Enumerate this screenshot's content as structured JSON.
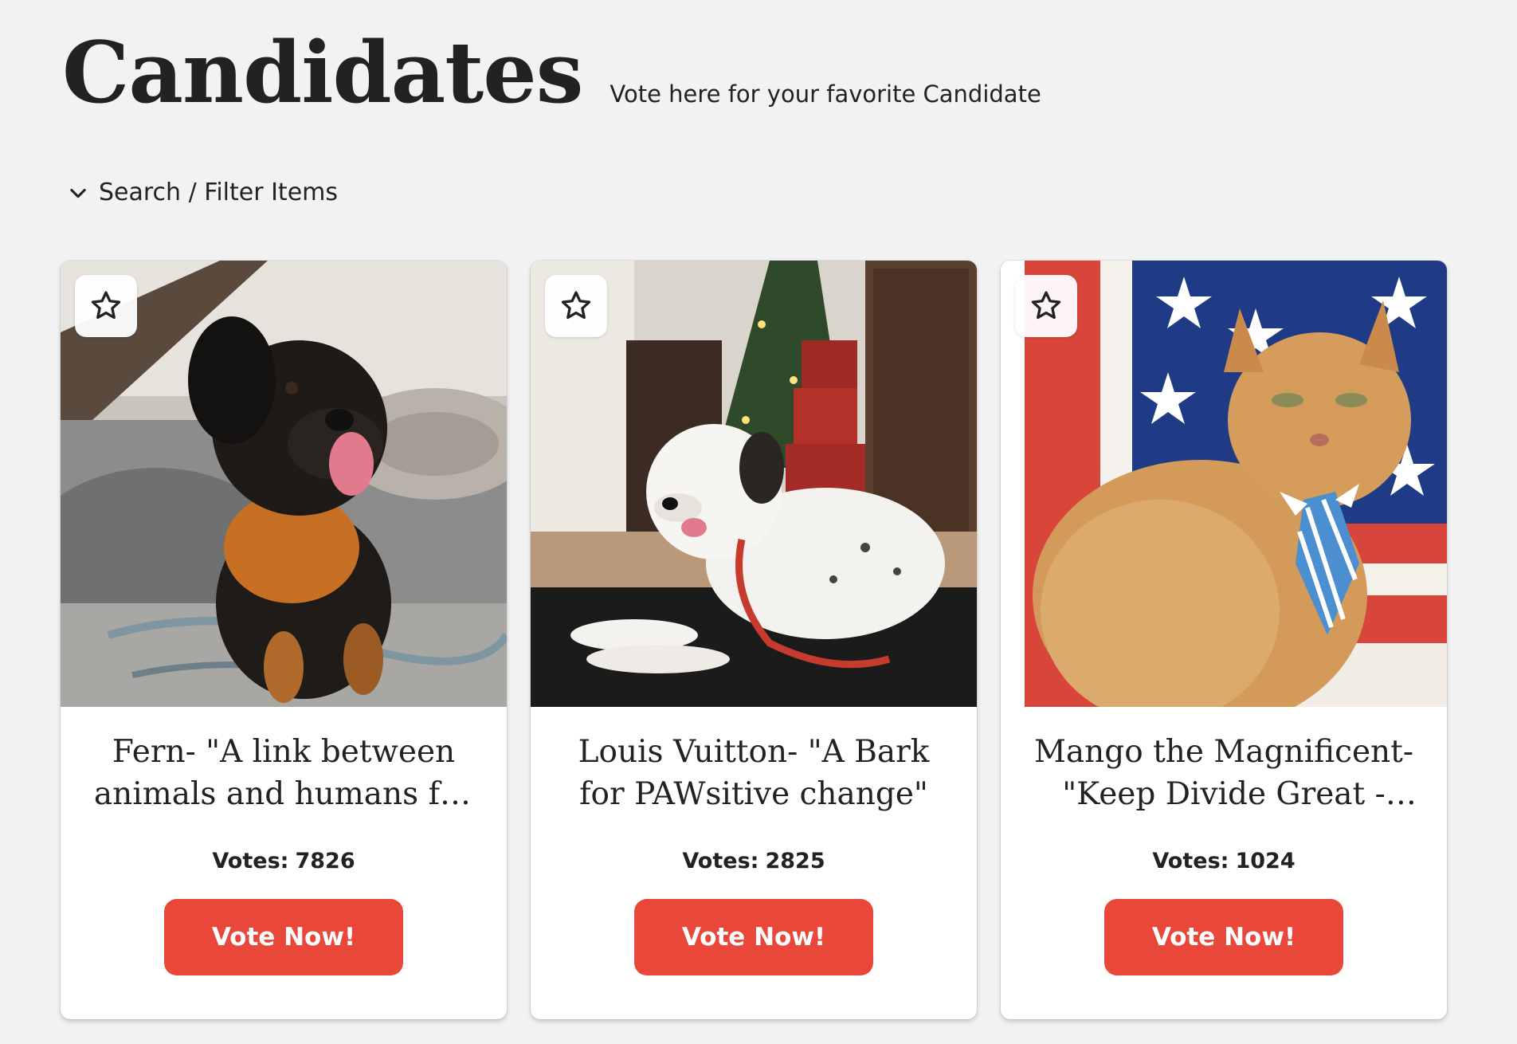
{
  "header": {
    "title": "Candidates",
    "subtitle": "Vote here for your favorite Candidate"
  },
  "filter": {
    "label": "Search / Filter Items",
    "icon": "chevron-down-icon"
  },
  "candidates": [
    {
      "title": "Fern- \"A link between animals and humans for ...",
      "votes_label": "Votes:",
      "votes": "7826",
      "button_label": "Vote Now!",
      "photo": "black-and-tan-dog-in-orange-harness-photo"
    },
    {
      "title": "Louis Vuitton- \"A Bark for PAWsitive change\"",
      "votes_label": "Votes:",
      "votes": "2825",
      "button_label": "Vote Now!",
      "photo": "white-dog-with-red-leash-by-christmas-tree-photo"
    },
    {
      "title": "Mango the Magnificent- \"Keep Divide Great - Vot...",
      "votes_label": "Votes:",
      "votes": "1024",
      "button_label": "Vote Now!",
      "photo": "orange-cat-with-blue-tie-and-flag-photo"
    }
  ],
  "colors": {
    "background": "#f2f2f2",
    "accent": "#e8473a",
    "card": "#ffffff",
    "text": "#222222"
  }
}
